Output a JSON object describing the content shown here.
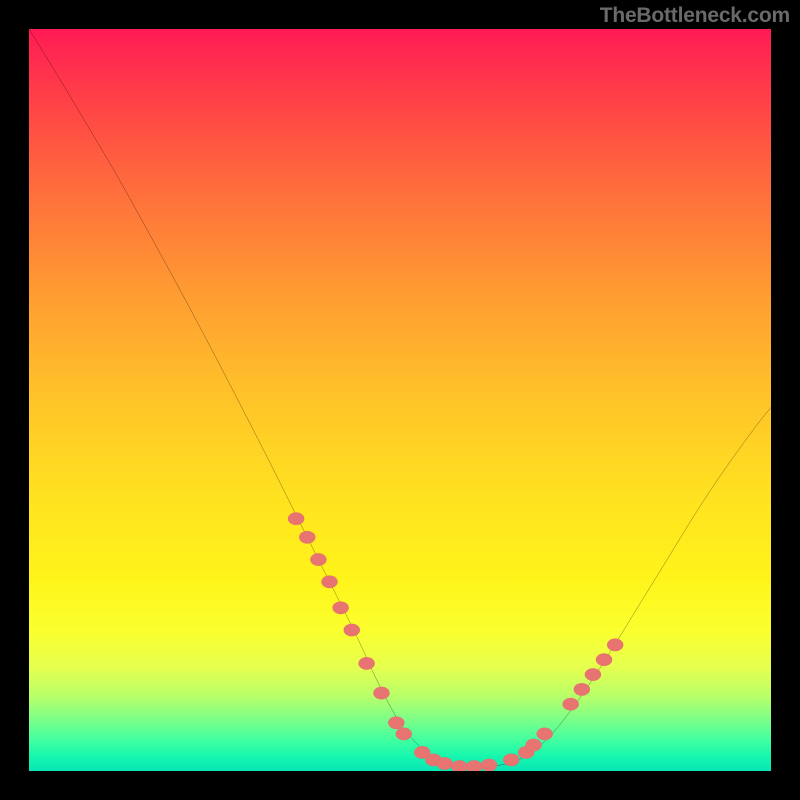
{
  "watermark": "TheBottleneck.com",
  "colors": {
    "curve": "#000000",
    "marker_fill": "#e77471",
    "marker_stroke": "#d45d5d",
    "page_bg": "#000000"
  },
  "chart_data": {
    "type": "line",
    "title": "",
    "xlabel": "",
    "ylabel": "",
    "xlim": [
      0,
      100
    ],
    "ylim": [
      0,
      100
    ],
    "grid": false,
    "legend": false,
    "series": [
      {
        "name": "bottleneck-curve",
        "x": [
          0,
          4,
          8,
          12,
          16,
          20,
          24,
          28,
          32,
          36,
          40,
          44,
          47,
          50,
          53,
          56,
          59,
          62,
          66,
          70,
          74,
          78,
          82,
          86,
          90,
          94,
          98,
          100
        ],
        "y": [
          100,
          93.5,
          86.8,
          80.0,
          72.8,
          65.5,
          58.0,
          50.3,
          42.5,
          34.5,
          26.5,
          18.5,
          12.0,
          6.5,
          3.0,
          1.2,
          0.5,
          0.6,
          1.5,
          4.5,
          9.5,
          15.5,
          22.0,
          28.5,
          35.0,
          41.0,
          46.5,
          49.0
        ]
      }
    ],
    "markers": {
      "name": "highlighted-points",
      "points": [
        {
          "x": 36.0,
          "y": 34.0
        },
        {
          "x": 37.5,
          "y": 31.5
        },
        {
          "x": 39.0,
          "y": 28.5
        },
        {
          "x": 40.5,
          "y": 25.5
        },
        {
          "x": 42.0,
          "y": 22.0
        },
        {
          "x": 43.5,
          "y": 19.0
        },
        {
          "x": 45.5,
          "y": 14.5
        },
        {
          "x": 47.5,
          "y": 10.5
        },
        {
          "x": 49.5,
          "y": 6.5
        },
        {
          "x": 50.5,
          "y": 5.0
        },
        {
          "x": 53.0,
          "y": 2.5
        },
        {
          "x": 54.5,
          "y": 1.5
        },
        {
          "x": 56.0,
          "y": 1.0
        },
        {
          "x": 58.0,
          "y": 0.6
        },
        {
          "x": 60.0,
          "y": 0.6
        },
        {
          "x": 62.0,
          "y": 0.8
        },
        {
          "x": 65.0,
          "y": 1.5
        },
        {
          "x": 67.0,
          "y": 2.5
        },
        {
          "x": 68.0,
          "y": 3.5
        },
        {
          "x": 69.5,
          "y": 5.0
        },
        {
          "x": 73.0,
          "y": 9.0
        },
        {
          "x": 74.5,
          "y": 11.0
        },
        {
          "x": 76.0,
          "y": 13.0
        },
        {
          "x": 77.5,
          "y": 15.0
        },
        {
          "x": 79.0,
          "y": 17.0
        }
      ]
    }
  }
}
